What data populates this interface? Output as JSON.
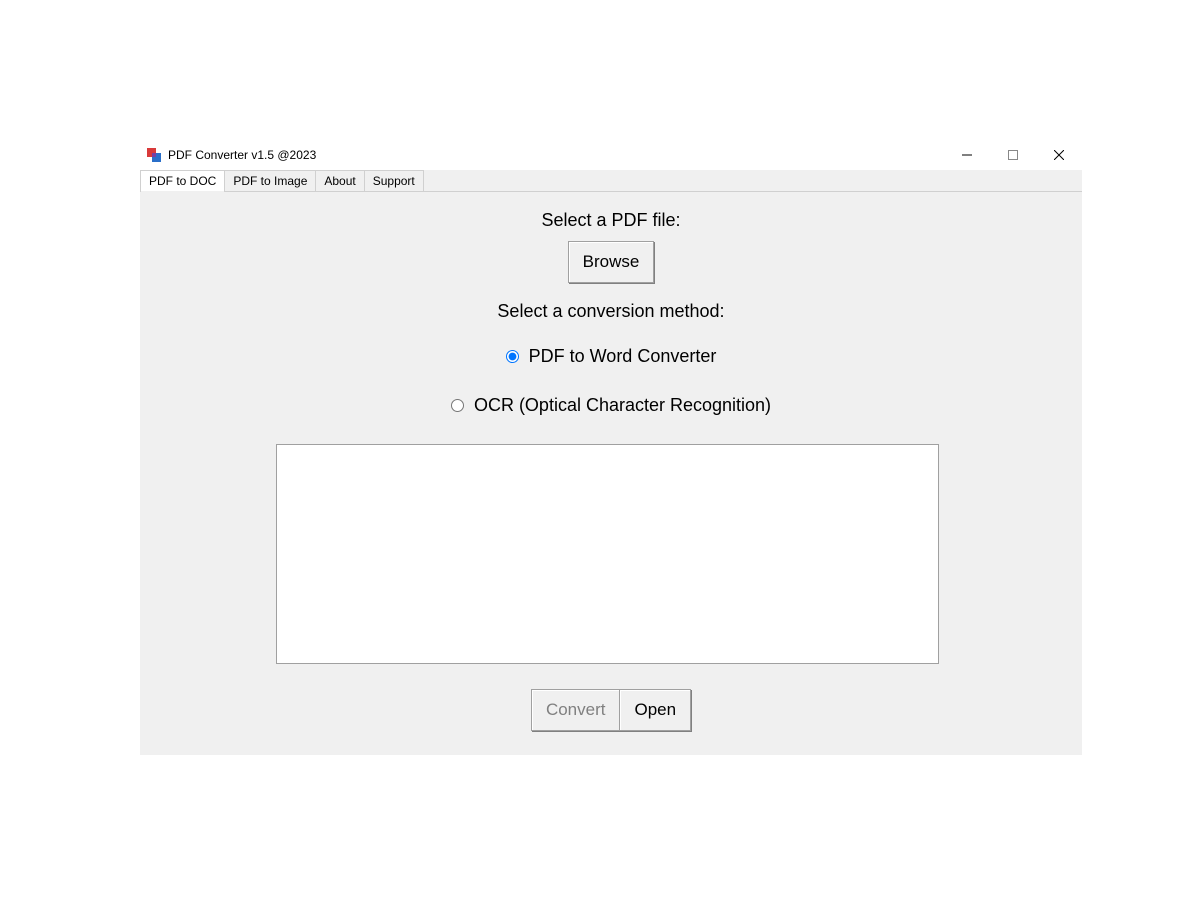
{
  "window": {
    "title": "PDF Converter v1.5 @2023"
  },
  "tabs": [
    {
      "label": "PDF to DOC",
      "active": true
    },
    {
      "label": "PDF to Image",
      "active": false
    },
    {
      "label": "About",
      "active": false
    },
    {
      "label": "Support",
      "active": false
    }
  ],
  "main": {
    "select_file_label": "Select a PDF file:",
    "browse_button": "Browse",
    "select_method_label": "Select a conversion method:",
    "radio_pdf_to_word": "PDF to Word Converter",
    "radio_ocr": "OCR (Optical Character Recognition)",
    "output_text": "",
    "convert_button": "Convert",
    "open_button": "Open"
  },
  "radio_selected": "pdf_to_word"
}
